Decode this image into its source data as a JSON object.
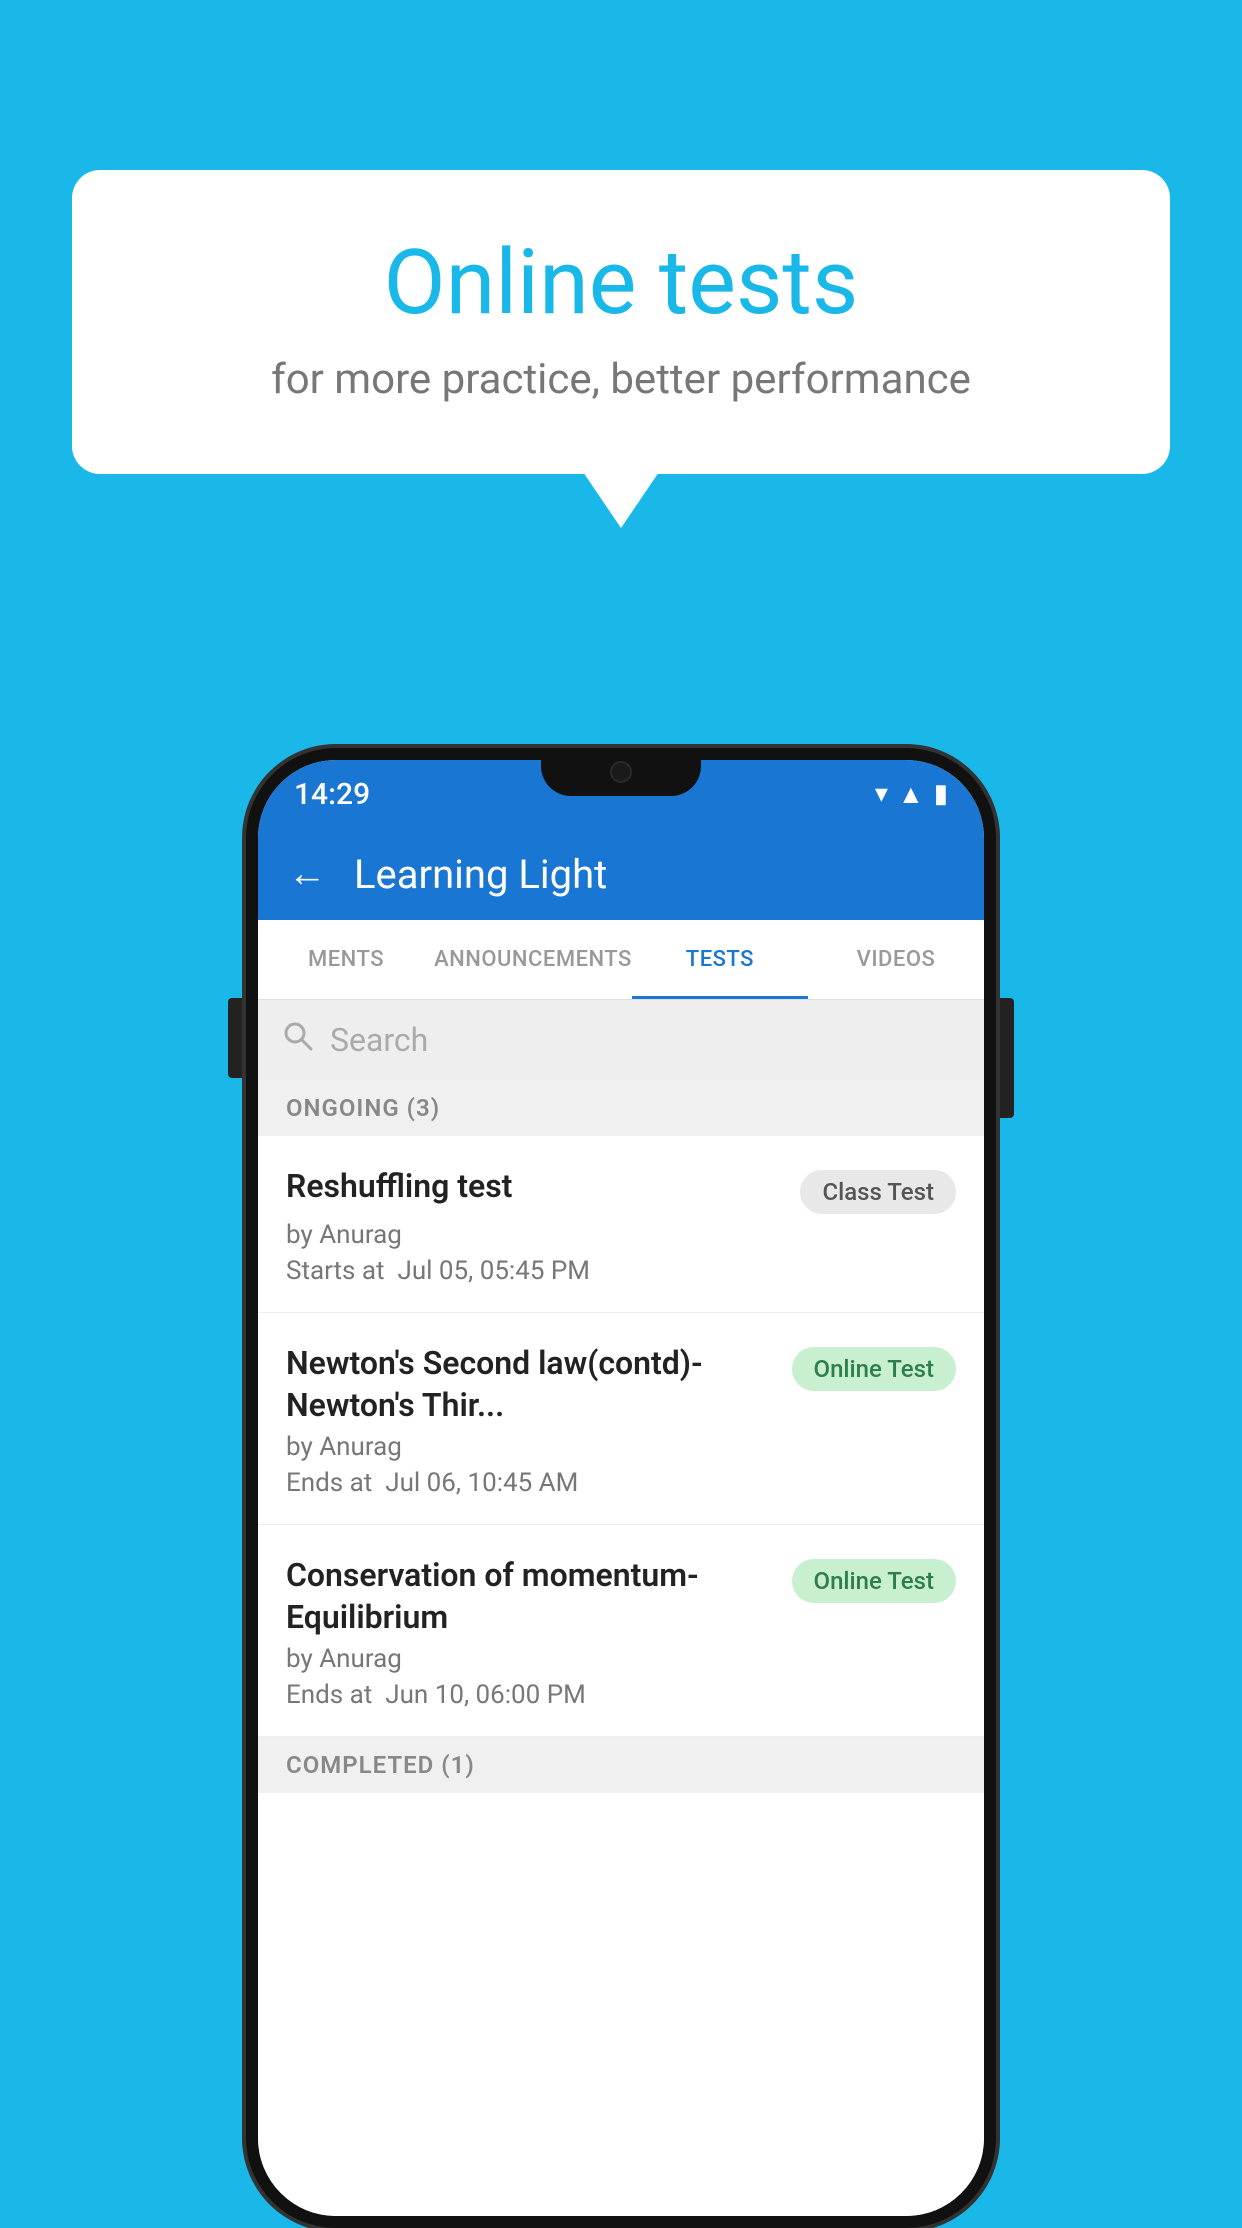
{
  "background_color": "#1ab8e8",
  "speech_bubble": {
    "title": "Online tests",
    "subtitle": "for more practice, better performance"
  },
  "phone": {
    "status_bar": {
      "time": "14:29",
      "wifi": "▼",
      "signal": "▲",
      "battery": "▐"
    },
    "app_bar": {
      "back_label": "←",
      "title": "Learning Light"
    },
    "tabs": [
      {
        "label": "MENTS",
        "active": false
      },
      {
        "label": "ANNOUNCEMENTS",
        "active": false
      },
      {
        "label": "TESTS",
        "active": true
      },
      {
        "label": "VIDEOS",
        "active": false
      }
    ],
    "search": {
      "placeholder": "Search"
    },
    "section_ongoing": {
      "label": "ONGOING (3)"
    },
    "test_items": [
      {
        "name": "Reshuffling test",
        "badge": "Class Test",
        "badge_type": "class",
        "by": "by Anurag",
        "date_label": "Starts at",
        "date": "Jul 05, 05:45 PM"
      },
      {
        "name": "Newton's Second law(contd)-Newton's Thir...",
        "badge": "Online Test",
        "badge_type": "online",
        "by": "by Anurag",
        "date_label": "Ends at",
        "date": "Jul 06, 10:45 AM"
      },
      {
        "name": "Conservation of momentum-Equilibrium",
        "badge": "Online Test",
        "badge_type": "online",
        "by": "by Anurag",
        "date_label": "Ends at",
        "date": "Jun 10, 06:00 PM"
      }
    ],
    "section_completed": {
      "label": "COMPLETED (1)"
    }
  }
}
